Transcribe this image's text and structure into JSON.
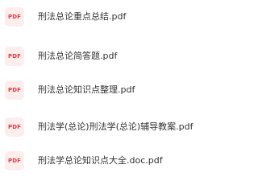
{
  "icon": {
    "name": "pdf-file-icon",
    "label": "PDF",
    "text_color": "#e8383d",
    "bg_color": "#fdeeee"
  },
  "files": [
    {
      "name": "刑法总论重点总结.pdf"
    },
    {
      "name": "刑法总论简答题.pdf"
    },
    {
      "name": "刑法总论知识点整理.pdf"
    },
    {
      "name": "刑法学(总论)刑法学(总论)辅导教案.pdf"
    },
    {
      "name": "刑法学总论知识点大全.doc.pdf"
    }
  ]
}
